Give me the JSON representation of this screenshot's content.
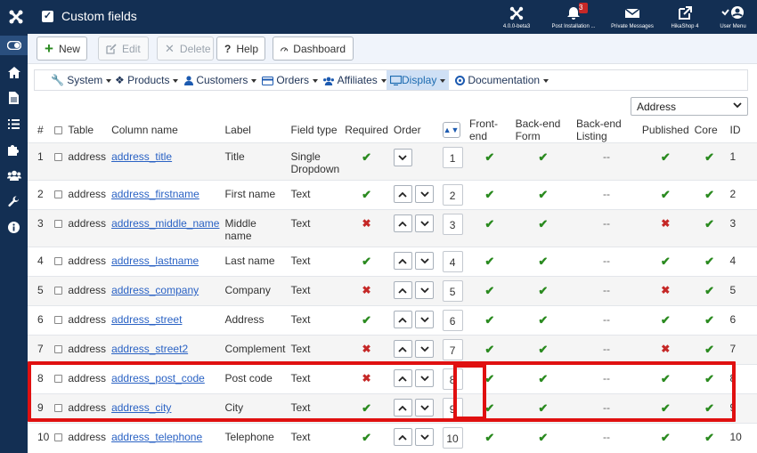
{
  "topbar": {
    "title": "Custom fields",
    "items": [
      {
        "icon": "joomla-icon",
        "label": "4.0.0-beta3"
      },
      {
        "icon": "bell-icon",
        "label": "Post Installation ...",
        "badge": "3"
      },
      {
        "icon": "envelope-icon",
        "label": "Private Messages"
      },
      {
        "icon": "external-link-icon",
        "label": "HikaShop 4"
      },
      {
        "icon": "user-icon",
        "label": "User Menu"
      }
    ]
  },
  "sidebar": {
    "items": [
      "toggle-icon",
      "home-icon",
      "file-icon",
      "list-icon",
      "puzzle-icon",
      "users-icon",
      "wrench-icon",
      "info-icon"
    ]
  },
  "toolbar": {
    "new_label": "New",
    "edit_label": "Edit",
    "delete_label": "Delete",
    "help_label": "Help",
    "dashboard_label": "Dashboard"
  },
  "menu": {
    "items": [
      "System",
      "Products",
      "Customers",
      "Orders",
      "Affiliates",
      "Display",
      "Documentation"
    ],
    "active": "Display"
  },
  "filter": {
    "table_select": "Address"
  },
  "columns": [
    "#",
    "Table",
    "Column name",
    "Label",
    "Field type",
    "Required",
    "Order",
    "Front-end",
    "Back-end Form",
    "Back-end Listing",
    "Published",
    "Core",
    "ID"
  ],
  "rows": [
    {
      "num": "1",
      "table": "address",
      "column": "address_title",
      "label": "Title",
      "type": "Single Dropdown",
      "required": true,
      "order": "1",
      "front": true,
      "backform": true,
      "backlist": "--",
      "published": true,
      "core": true,
      "id": "1"
    },
    {
      "num": "2",
      "table": "address",
      "column": "address_firstname",
      "label": "First name",
      "type": "Text",
      "required": true,
      "order": "2",
      "front": true,
      "backform": true,
      "backlist": "--",
      "published": true,
      "core": true,
      "id": "2"
    },
    {
      "num": "3",
      "table": "address",
      "column": "address_middle_name",
      "label": "Middle name",
      "type": "Text",
      "required": false,
      "order": "3",
      "front": true,
      "backform": true,
      "backlist": "--",
      "published": false,
      "core": true,
      "id": "3"
    },
    {
      "num": "4",
      "table": "address",
      "column": "address_lastname",
      "label": "Last name",
      "type": "Text",
      "required": true,
      "order": "4",
      "front": true,
      "backform": true,
      "backlist": "--",
      "published": true,
      "core": true,
      "id": "4"
    },
    {
      "num": "5",
      "table": "address",
      "column": "address_company",
      "label": "Company",
      "type": "Text",
      "required": false,
      "order": "5",
      "front": true,
      "backform": true,
      "backlist": "--",
      "published": false,
      "core": true,
      "id": "5"
    },
    {
      "num": "6",
      "table": "address",
      "column": "address_street",
      "label": "Address",
      "type": "Text",
      "required": true,
      "order": "6",
      "front": true,
      "backform": true,
      "backlist": "--",
      "published": true,
      "core": true,
      "id": "6"
    },
    {
      "num": "7",
      "table": "address",
      "column": "address_street2",
      "label": "Complement",
      "type": "Text",
      "required": false,
      "order": "7",
      "front": true,
      "backform": true,
      "backlist": "--",
      "published": false,
      "core": true,
      "id": "7"
    },
    {
      "num": "8",
      "table": "address",
      "column": "address_post_code",
      "label": "Post code",
      "type": "Text",
      "required": false,
      "order": "8",
      "front": true,
      "backform": true,
      "backlist": "--",
      "published": true,
      "core": true,
      "id": "8"
    },
    {
      "num": "9",
      "table": "address",
      "column": "address_city",
      "label": "City",
      "type": "Text",
      "required": true,
      "order": "9",
      "front": true,
      "backform": true,
      "backlist": "--",
      "published": true,
      "core": true,
      "id": "9"
    },
    {
      "num": "10",
      "table": "address",
      "column": "address_telephone",
      "label": "Telephone",
      "type": "Text",
      "required": true,
      "order": "10",
      "front": true,
      "backform": true,
      "backlist": "--",
      "published": true,
      "core": true,
      "id": "10"
    }
  ],
  "colors": {
    "header_bg": "#132f53",
    "check": "#2a8a1f",
    "cross": "#c52827",
    "highlight": "#e01010",
    "link": "#2a62c4"
  }
}
